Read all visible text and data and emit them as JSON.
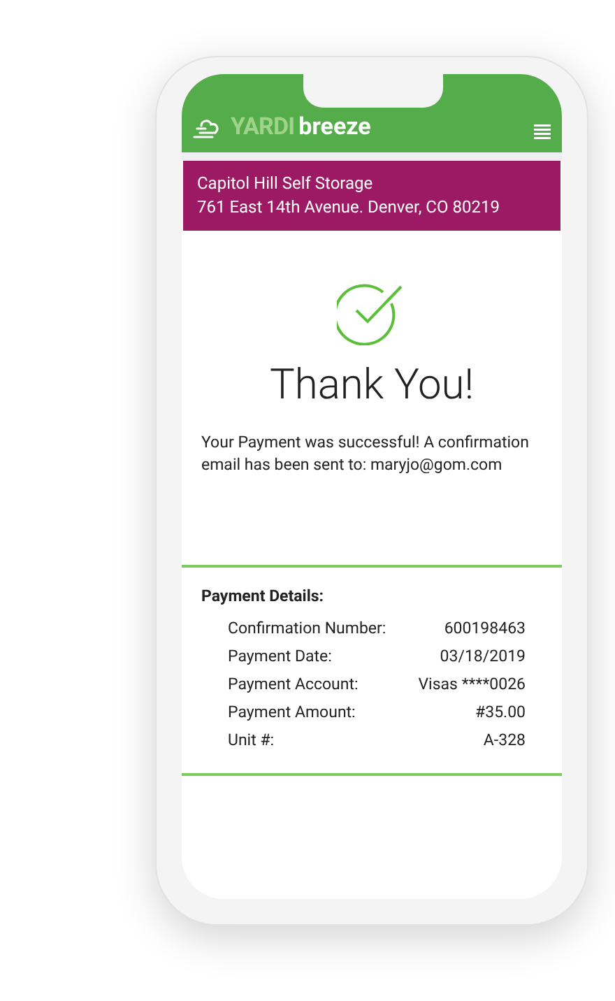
{
  "header": {
    "logo_left": "YARDI",
    "logo_right": "breeze"
  },
  "facility": {
    "name": "Capitol Hill Self Storage",
    "address": "761 East 14th Avenue. Denver, CO 80219"
  },
  "confirmation": {
    "title": "Thank You!",
    "message": "Your Payment was successful! A confirmation email has been sent to: maryjo@gom.com"
  },
  "payment_details": {
    "title": "Payment Details:",
    "rows": [
      {
        "label": "Confirmation Number:",
        "value": "600198463"
      },
      {
        "label": "Payment Date:",
        "value": "03/18/2019"
      },
      {
        "label": "Payment Account:",
        "value": "Visas ****0026"
      },
      {
        "label": "Payment Amount:",
        "value": "#35.00"
      },
      {
        "label": "Unit #:",
        "value": "A-328"
      }
    ]
  }
}
